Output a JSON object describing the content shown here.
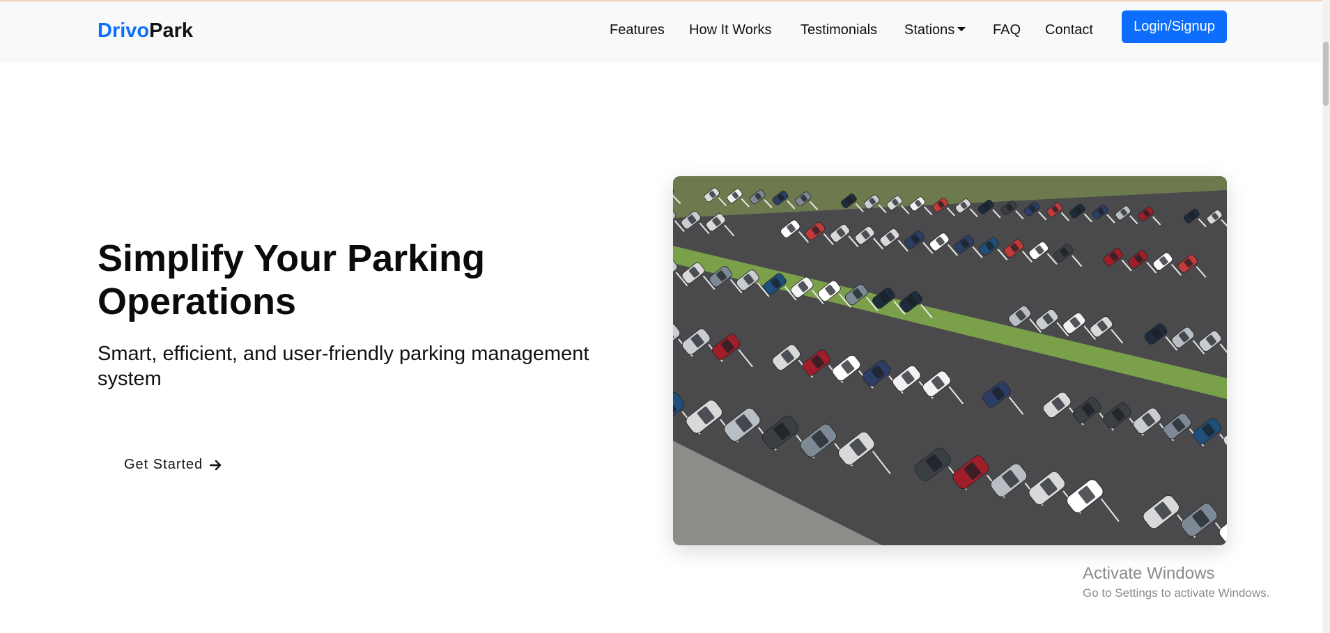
{
  "brand": {
    "part1": "Drivo",
    "part2": "Park"
  },
  "nav": {
    "items": [
      "Features",
      "How It Works",
      "Testimonials",
      "Stations",
      "FAQ",
      "Contact"
    ],
    "login_label": "Login/Signup"
  },
  "hero": {
    "title": "Simplify Your Parking Operations",
    "subtitle": "Smart, efficient, and user-friendly parking management system",
    "cta_label": "Get Started",
    "image_icon": "parking-lot-photo"
  },
  "watermark": {
    "line1": "Activate Windows",
    "line2": "Go to Settings to activate Windows."
  },
  "colors": {
    "brand_blue": "#0d6efd",
    "navbar_bg": "#f8f9fa",
    "text": "#111111"
  }
}
